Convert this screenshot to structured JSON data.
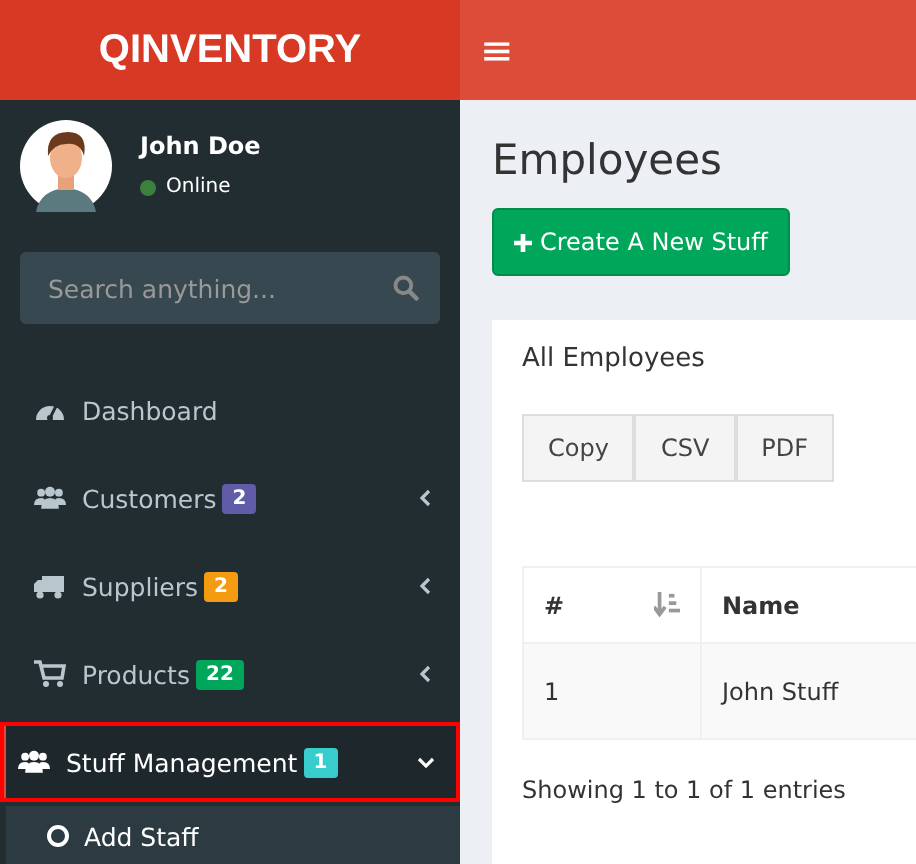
{
  "header": {
    "logo": "QINVENTORY",
    "menu_toggle": "≡"
  },
  "user": {
    "name": "John Doe",
    "status": "Online",
    "online": true
  },
  "search": {
    "placeholder": "Search anything..."
  },
  "menu": [
    {
      "label": "Dashboard",
      "kind": "link",
      "selected": false
    },
    {
      "label": "Customers",
      "kind": "tree",
      "badge": "2",
      "color": "#605ca8",
      "expanded": false,
      "selected": false
    },
    {
      "label": "Suppliers",
      "kind": "tree",
      "badge": "2",
      "color": "#f39c12",
      "expanded": false,
      "selected": false
    },
    {
      "label": "Products",
      "kind": "tree",
      "badge": "22",
      "color": "#00a65a",
      "expanded": false,
      "selected": false
    },
    {
      "label": "Stuff Management",
      "kind": "tree",
      "badge": "1",
      "color": "#39cccc",
      "expanded": true,
      "selected": true,
      "children": [
        {
          "label": "Add Staff"
        }
      ]
    }
  ],
  "page": {
    "title": "Employees",
    "create_button": "Create A New Stuff"
  },
  "box": {
    "title": "All Employees",
    "export_buttons": [
      "Copy",
      "CSV",
      "PDF"
    ],
    "table": {
      "columns": [
        {
          "label": "#",
          "sorted": true
        },
        {
          "label": "Name",
          "sorted": false
        }
      ],
      "rows": [
        [
          "1",
          "John Stuff"
        ]
      ]
    },
    "info": "Showing 1 to 1 of 1 entries"
  }
}
